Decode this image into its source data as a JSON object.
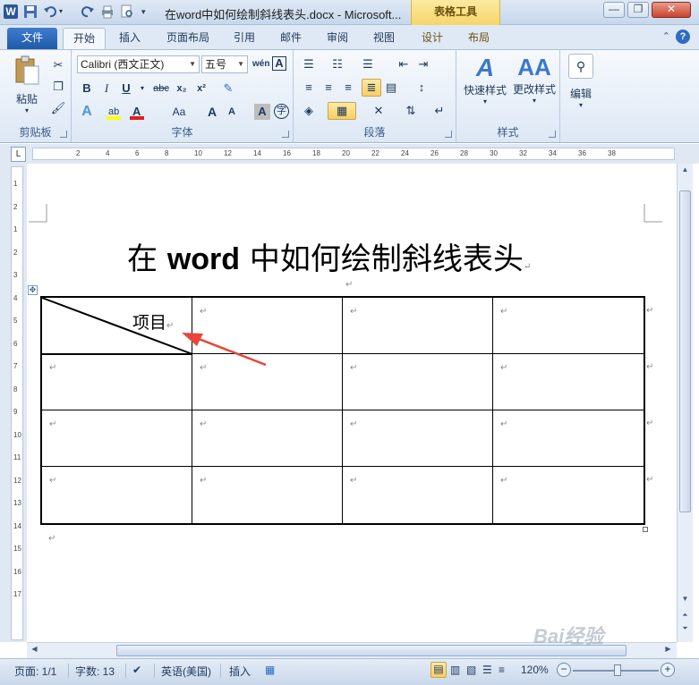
{
  "window": {
    "title": "在word中如何绘制斜线表头.docx - Microsoft...",
    "contextual_tab_group": "表格工具",
    "minimize_icon": "minimize-icon",
    "restore_icon": "restore-icon",
    "close_icon": "close-icon"
  },
  "tabs": [
    "文件",
    "开始",
    "插入",
    "页面布局",
    "引用",
    "邮件",
    "审阅",
    "视图",
    "设计",
    "布局"
  ],
  "ribbon": {
    "clipboard": {
      "paste": "粘贴",
      "label": "剪贴板"
    },
    "font": {
      "font_name": "Calibri (西文正文)",
      "font_size": "五号",
      "label": "字体",
      "bold": "B",
      "italic": "I",
      "underline": "U",
      "strike": "abc",
      "sub": "x₂",
      "sup": "x²",
      "case": "Aa",
      "grow": "A",
      "shrink": "A",
      "char_shading": "A",
      "enclose": "字",
      "phonetic": "wén"
    },
    "paragraph": {
      "label": "段落"
    },
    "styles": {
      "quick": "快速样式",
      "change": "更改样式",
      "label": "样式"
    },
    "editing": {
      "label": "编辑"
    }
  },
  "ruler": {
    "h_ticks": [
      "2",
      "4",
      "6",
      "8",
      "10",
      "12",
      "14",
      "16",
      "18",
      "20",
      "22",
      "24",
      "26",
      "28",
      "30",
      "32",
      "34",
      "36",
      "38"
    ],
    "v_ticks": [
      "1",
      "2",
      "1",
      "2",
      "3",
      "4",
      "5",
      "6",
      "7",
      "8",
      "9",
      "10",
      "11",
      "12",
      "13",
      "14",
      "15",
      "16",
      "17"
    ]
  },
  "document": {
    "title_prefix": "在 ",
    "title_latin": "word",
    "title_suffix": " 中如何绘制斜线表头",
    "table_header_text": "项目",
    "para_mark": "↵",
    "move_handle": "✥"
  },
  "status": {
    "page": "页面: 1/1",
    "words": "字数: 13",
    "language": "英语(美国)",
    "mode": "插入",
    "zoom": "120%",
    "zoom_out": "−",
    "zoom_in": "+"
  },
  "watermark": "Bai经验",
  "colors": {
    "accent": "#2b579a",
    "table_tools": "#f6d66a",
    "arrow": "#e8453c"
  }
}
